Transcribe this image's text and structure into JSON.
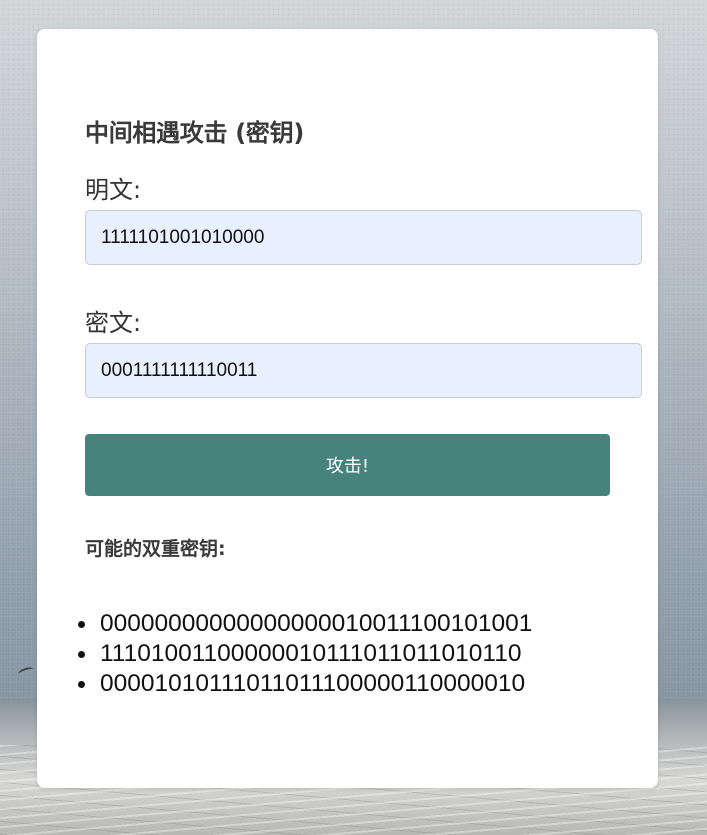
{
  "form": {
    "title": "中间相遇攻击 (密钥)",
    "plaintext_label": "明文:",
    "plaintext_value": "1111101001010000",
    "ciphertext_label": "密文:",
    "ciphertext_value": "0001111111110011",
    "attack_button_label": "攻击!"
  },
  "results": {
    "heading": "可能的双重密钥:",
    "keys": [
      "00000000000000000010011100101001",
      "11101001100000010111011011010110",
      "00001010111011011100000110000010"
    ]
  },
  "colors": {
    "button_bg": "#47837d",
    "input_bg": "#e8f0fe",
    "card_bg": "#ffffff"
  }
}
